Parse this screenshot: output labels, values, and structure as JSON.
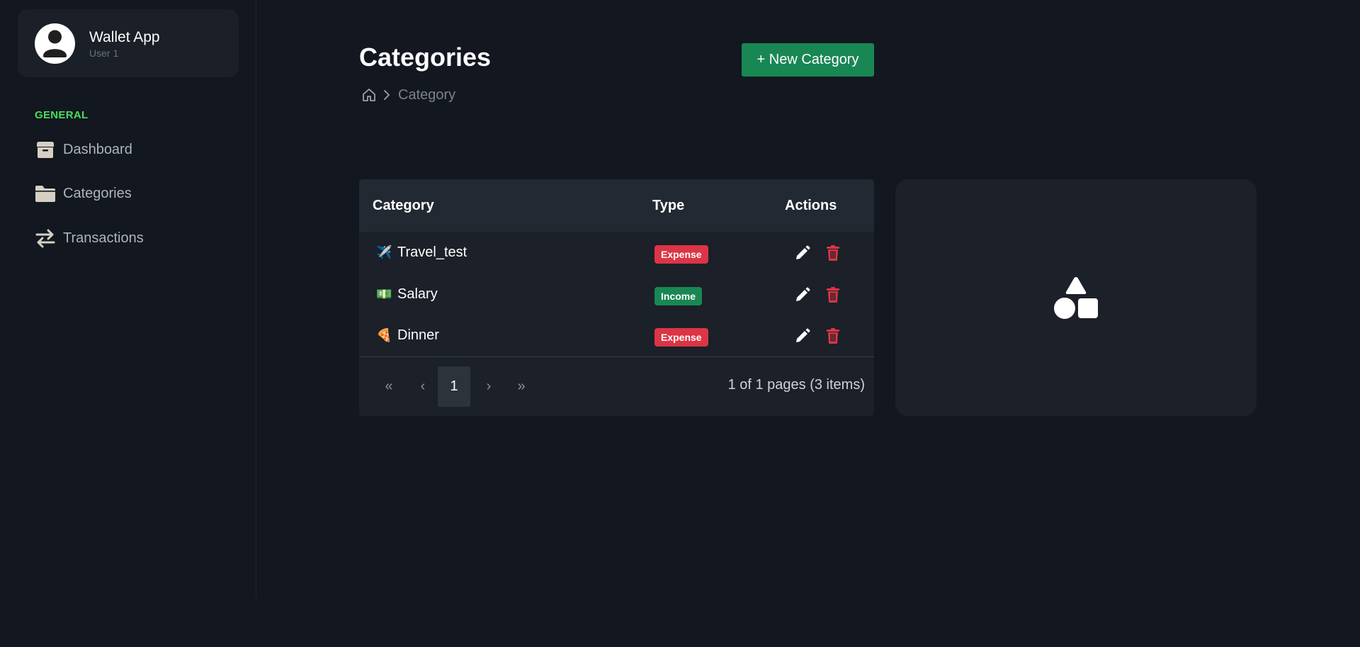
{
  "sidebar": {
    "app_name": "Wallet App",
    "user_name": "User 1",
    "section_label": "GENERAL",
    "items": [
      {
        "label": "Dashboard",
        "icon": "archive-box-icon"
      },
      {
        "label": "Categories",
        "icon": "folder-icon"
      },
      {
        "label": "Transactions",
        "icon": "arrows-exchange-icon"
      }
    ]
  },
  "header": {
    "title": "Categories",
    "breadcrumb": {
      "home_icon": "home-icon",
      "current": "Category"
    },
    "new_button_label": "+ New Category"
  },
  "table": {
    "columns": [
      "Category",
      "Type",
      "Actions"
    ],
    "rows": [
      {
        "emoji": "✈️",
        "name": "Travel_test",
        "type": "Expense"
      },
      {
        "emoji": "💵",
        "name": "Salary",
        "type": "Income"
      },
      {
        "emoji": "🍕",
        "name": "Dinner",
        "type": "Expense"
      }
    ],
    "pager": {
      "first": "«",
      "prev": "‹",
      "current_page": "1",
      "next": "›",
      "last": "»",
      "summary": "1 of 1 pages (3 items)"
    }
  },
  "colors": {
    "accent_green": "#198754",
    "section_label_green": "#4ade5a",
    "expense_badge": "#dc3545",
    "income_badge": "#198754",
    "delete_icon": "#dc3545",
    "background": "#121720"
  }
}
